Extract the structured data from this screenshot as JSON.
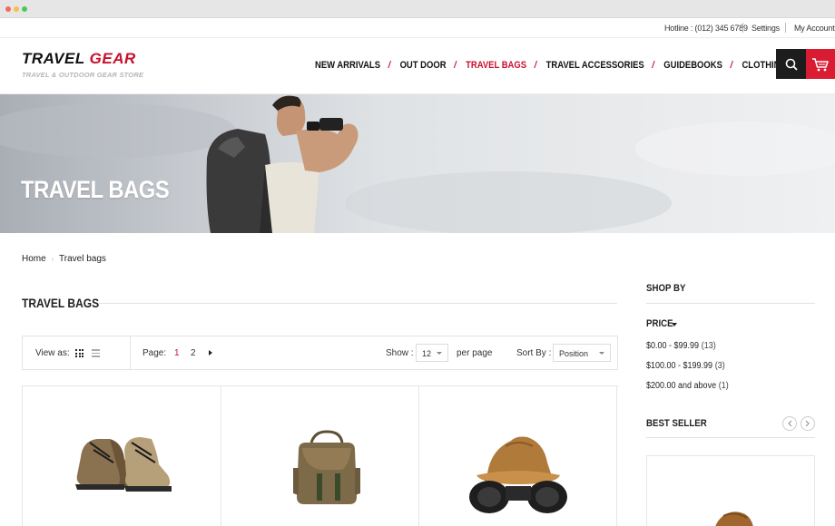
{
  "topbar": {
    "hotline": "Hotline : (012) 345 6789",
    "settings": "Settings",
    "account": "My Account"
  },
  "logo": {
    "word1": "TRAVEL",
    "word2": "GEAR",
    "tagline": "TRAVEL & OUTDOOR GEAR STORE"
  },
  "nav": {
    "items": [
      {
        "label": "NEW ARRIVALS"
      },
      {
        "label": "OUT DOOR"
      },
      {
        "label": "TRAVEL BAGS"
      },
      {
        "label": "TRAVEL ACCESSORIES"
      },
      {
        "label": "GUIDEBOOKS"
      },
      {
        "label": "CLOTHING"
      }
    ],
    "separator": "/"
  },
  "hero": {
    "title": "TRAVEL BAGS"
  },
  "breadcrumb": {
    "home": "Home",
    "current": "Travel bags",
    "separator": "›"
  },
  "main": {
    "title": "TRAVEL BAGS",
    "toolbar": {
      "view_as": "View as:",
      "page_label": "Page:",
      "pages": [
        "1",
        "2"
      ],
      "show_label": "Show :",
      "show_value": "12",
      "per_page": "per page",
      "sort_label": "Sort By :",
      "sort_value": "Position"
    }
  },
  "sidebar": {
    "shop_by": "SHOP BY",
    "price_label": "PRICE",
    "price_ranges": [
      {
        "range": "$0.00 - $99.99",
        "count": "(13)"
      },
      {
        "range": "$100.00 - $199.99",
        "count": "(3)"
      },
      {
        "range": "$200.00 and above",
        "count": "(1)"
      }
    ],
    "best_seller": "BEST SELLER"
  },
  "colors": {
    "accent": "#c8102e",
    "dark": "#1d1d1d",
    "cart": "#d91c31"
  }
}
